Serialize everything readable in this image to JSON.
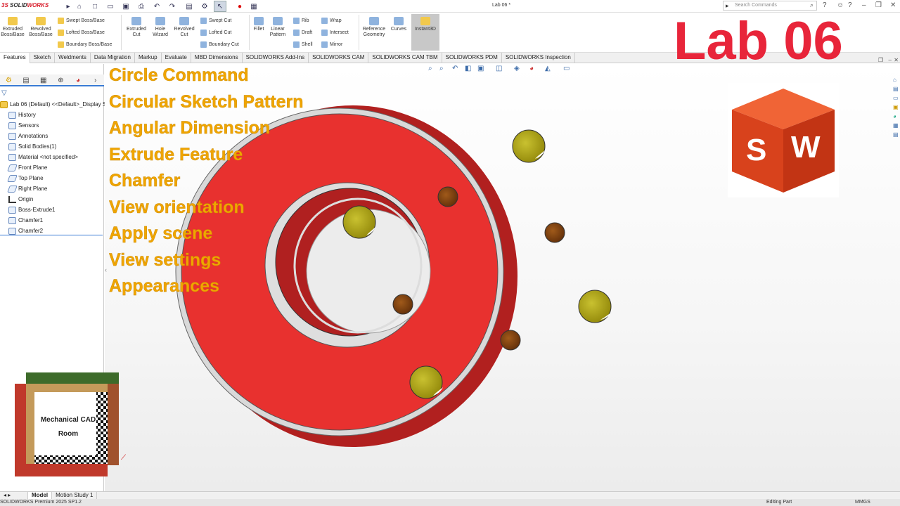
{
  "app": {
    "logo_left": "3S",
    "logo_solid": "SOLID",
    "logo_works": "WORKS",
    "doc_title": "Lab 06 *"
  },
  "search": {
    "placeholder": "Search Commands"
  },
  "ribbon": {
    "extruded_boss": "Extruded Boss/Base",
    "revolved_boss": "Revolved Boss/Base",
    "swept_boss": "Swept Boss/Base",
    "lofted_boss": "Lofted Boss/Base",
    "boundary_boss": "Boundary Boss/Base",
    "extruded_cut": "Extruded Cut",
    "hole_wizard": "Hole Wizard",
    "revolved_cut": "Revolved Cut",
    "swept_cut": "Swept Cut",
    "lofted_cut": "Lofted Cut",
    "boundary_cut": "Boundary Cut",
    "fillet": "Fillet",
    "linear_pattern": "Linear Pattern",
    "rib": "Rib",
    "draft": "Draft",
    "shell": "Shell",
    "wrap": "Wrap",
    "intersect": "Intersect",
    "mirror": "Mirror",
    "ref_geometry": "Reference Geometry",
    "curves": "Curves",
    "instant3d": "Instant3D"
  },
  "tabs": [
    "Features",
    "Sketch",
    "Weldments",
    "Data Migration",
    "Markup",
    "Evaluate",
    "MBD Dimensions",
    "SOLIDWORKS Add-Ins",
    "SOLIDWORKS CAM",
    "SOLIDWORKS CAM TBM",
    "SOLIDWORKS PDM",
    "SOLIDWORKS Inspection"
  ],
  "tree": {
    "root": "Lab 06 (Default) <<Default>_Display S",
    "items": [
      "History",
      "Sensors",
      "Annotations",
      "Solid Bodies(1)",
      "Material <not specified>",
      "Front Plane",
      "Top Plane",
      "Right Plane",
      "Origin",
      "Boss-Extrude1",
      "Chamfer1",
      "Chamfer2"
    ]
  },
  "overlay": {
    "lab_title": "Lab 06",
    "topics": [
      "Circle Command",
      "Circular Sketch Pattern",
      "Angular Dimension",
      "Extrude Feature",
      "Chamfer",
      "View orientation",
      "Apply scene",
      "View settings",
      "Appearances"
    ],
    "sw_s": "S",
    "sw_w": "W",
    "mcad_line1": "Mechanical CAD",
    "mcad_line2": "Room"
  },
  "bottom_tabs": [
    "Model",
    "Motion Study 1"
  ],
  "status": {
    "left": "SOLIDWORKS Premium 2025 SP1.2",
    "mid": "Editing Part",
    "right": "MMGS"
  },
  "colors": {
    "part_red": "#e8312f",
    "accent_red": "#e8253a",
    "topic_gold": "#f0a500",
    "hole_olive": "#a39a0e",
    "hole_brown": "#7a3e10"
  }
}
